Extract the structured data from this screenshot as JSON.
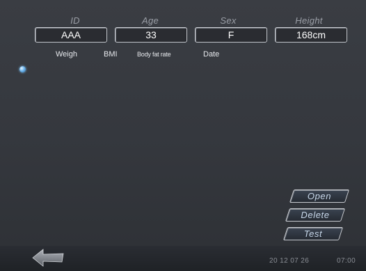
{
  "header": {
    "id_label": "ID",
    "age_label": "Age",
    "sex_label": "Sex",
    "height_label": "Height"
  },
  "fields": {
    "id_value": "AAA",
    "age_value": "33",
    "sex_value": "F",
    "height_value": "168cm"
  },
  "columns": {
    "weigh": "Weigh",
    "bmi": "BMI",
    "body_fat_rate": "Body fat rate",
    "date": "Date"
  },
  "buttons": {
    "open": "Open",
    "delete": "Delete",
    "test": "Test"
  },
  "status": {
    "date": "20 12 07 26",
    "time": "07:00"
  },
  "icons": {
    "back": "back-arrow-icon",
    "indicator": "blue-dot-icon"
  },
  "colors": {
    "background": "#35383e",
    "field_border": "#c9ccd2",
    "button_text": "#c7d7ea",
    "indicator": "#6fb6ee"
  }
}
